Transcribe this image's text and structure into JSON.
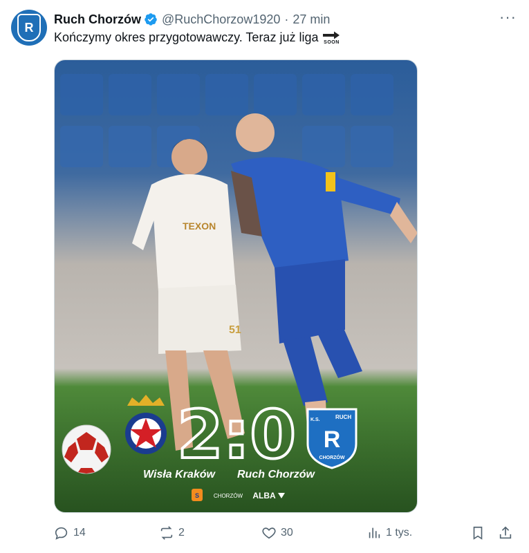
{
  "tweet": {
    "author_name": "Ruch Chorzów",
    "handle": "@RuchChorzow1920",
    "separator": "·",
    "time": "27 min",
    "text": "Kończymy okres przygotowawczy. Teraz już liga",
    "emoji_label": "SOON"
  },
  "media": {
    "score": "2:0",
    "home_team": "Wisła Kraków",
    "away_team": "Ruch Chorzów",
    "away_badge_text": "RUCH",
    "away_badge_sub": "CHORZÓW",
    "away_badge_ks": "K.S.",
    "sponsors": [
      "CHORZÓW",
      "ALBA"
    ],
    "jersey_sponsor": "TEXON",
    "jersey_number": "51"
  },
  "actions": {
    "replies": "14",
    "reposts": "2",
    "likes": "30",
    "views": "1 tys."
  },
  "colors": {
    "brand_blue": "#1f6fb7",
    "verified": "#1d9bf0",
    "muted": "#536471"
  }
}
